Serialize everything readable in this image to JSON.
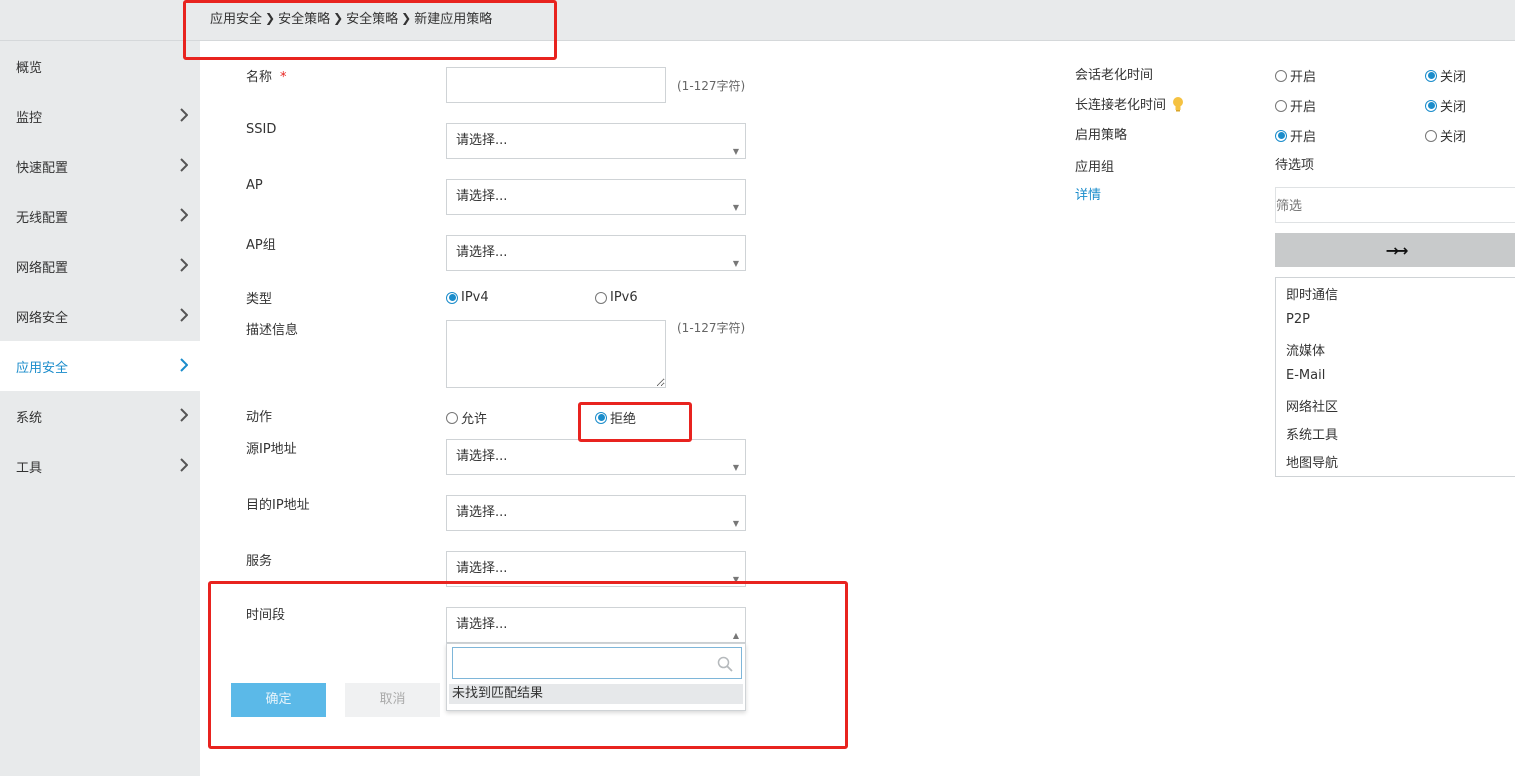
{
  "breadcrumb": [
    "应用安全",
    "安全策略",
    "安全策略",
    "新建应用策略"
  ],
  "sidebar": {
    "items": [
      {
        "label": "概览",
        "has_arrow": false
      },
      {
        "label": "监控",
        "has_arrow": true
      },
      {
        "label": "快速配置",
        "has_arrow": true
      },
      {
        "label": "无线配置",
        "has_arrow": true
      },
      {
        "label": "网络配置",
        "has_arrow": true
      },
      {
        "label": "网络安全",
        "has_arrow": true
      },
      {
        "label": "应用安全",
        "has_arrow": true,
        "active": true
      },
      {
        "label": "系统",
        "has_arrow": true
      },
      {
        "label": "工具",
        "has_arrow": true
      }
    ]
  },
  "form": {
    "name_label": "名称",
    "required_mark": "*",
    "name_value": "",
    "name_hint": "(1-127字符)",
    "ssid_label": "SSID",
    "ap_label": "AP",
    "apgroup_label": "AP组",
    "select_placeholder": "请选择...",
    "type_label": "类型",
    "type_options": [
      "IPv4",
      "IPv6"
    ],
    "type_selected": "IPv4",
    "desc_label": "描述信息",
    "desc_hint": "(1-127字符)",
    "action_label": "动作",
    "action_options": [
      "允许",
      "拒绝"
    ],
    "action_selected": "拒绝",
    "src_ip_label": "源IP地址",
    "dst_ip_label": "目的IP地址",
    "service_label": "服务",
    "time_label": "时间段",
    "dropdown_search_value": "",
    "dropdown_no_result": "未找到匹配结果",
    "ok_label": "确定",
    "cancel_label": "取消"
  },
  "right_panel": {
    "session_aging_label": "会话老化时间",
    "long_conn_aging_label": "长连接老化时间",
    "enable_policy_label": "启用策略",
    "app_group_label": "应用组",
    "details_link": "详情",
    "on_label": "开启",
    "off_label": "关闭",
    "session_aging_selected": "关闭",
    "long_conn_aging_selected": "关闭",
    "enable_policy_selected": "开启",
    "candidates_title": "待选项",
    "filter_placeholder": "筛选",
    "move_button": "→→",
    "candidates": [
      "即时通信",
      "P2P",
      "流媒体",
      "E-Mail",
      "网络社区",
      "系统工具",
      "地图导航"
    ]
  },
  "colors": {
    "accent": "#1a8ccb",
    "highlight_box": "#e8231f",
    "ok_button": "#5bb9e8",
    "sidebar_bg": "#e8eaeb",
    "bulb": "#f5c242"
  },
  "icons": {
    "chevron": "chevron-right-icon",
    "search": "search-icon",
    "bulb": "lightbulb-icon",
    "move": "double-arrow-right-icon"
  }
}
